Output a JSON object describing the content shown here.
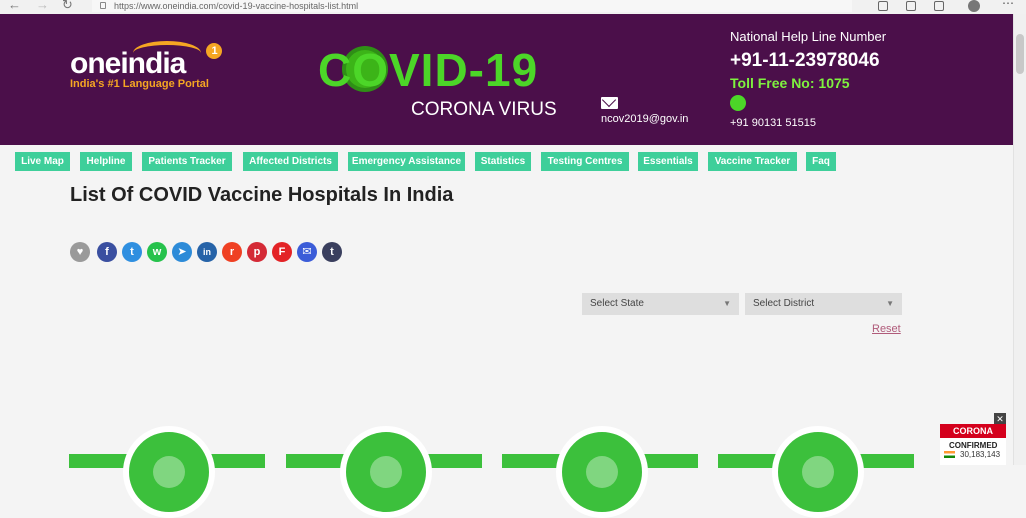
{
  "browser": {
    "url": "https://www.oneindia.com/covid-19-vaccine-hospitals-list.html"
  },
  "header": {
    "logo_text": "oneindia",
    "logo_badge": "1",
    "tagline": "India's #1 Language Portal",
    "covid_title": "COVID-19",
    "covid_subtitle": "CORONA VIRUS",
    "email": "ncov2019@gov.in",
    "helpline_label": "National Help Line Number",
    "helpline_number": "+91-11-23978046",
    "toll_free": "Toll Free No: 1075",
    "whatsapp_number": "+91 90131 51515"
  },
  "nav": {
    "tabs": [
      {
        "label": "Live Map"
      },
      {
        "label": "Helpline"
      },
      {
        "label": "Patients Tracker"
      },
      {
        "label": "Affected Districts"
      },
      {
        "label": "Emergency Assistance"
      },
      {
        "label": "Statistics"
      },
      {
        "label": "Testing Centres"
      },
      {
        "label": "Essentials"
      },
      {
        "label": "Vaccine Tracker"
      },
      {
        "label": "Faq"
      }
    ]
  },
  "main": {
    "title": "List Of COVID Vaccine Hospitals In India",
    "share_icons": [
      {
        "icon": "heart-icon",
        "glyph": "♥",
        "color": "#9a9a9a"
      },
      {
        "icon": "facebook-icon",
        "glyph": "f",
        "color": "#3a4fa0"
      },
      {
        "icon": "twitter-icon",
        "glyph": "t",
        "color": "#2f8fe0"
      },
      {
        "icon": "whatsapp-icon",
        "glyph": "w",
        "color": "#26c24c"
      },
      {
        "icon": "telegram-icon",
        "glyph": "➤",
        "color": "#2d8bd8"
      },
      {
        "icon": "linkedin-icon",
        "glyph": "in",
        "color": "#2663a8"
      },
      {
        "icon": "reddit-icon",
        "glyph": "r",
        "color": "#ef4023"
      },
      {
        "icon": "pinterest-icon",
        "glyph": "p",
        "color": "#d42a36"
      },
      {
        "icon": "flipboard-icon",
        "glyph": "F",
        "color": "#e32326"
      },
      {
        "icon": "email-icon",
        "glyph": "✉",
        "color": "#3b5cd8"
      },
      {
        "icon": "tumblr-icon",
        "glyph": "t",
        "color": "#3a3f5e"
      }
    ],
    "select_state": "Select State",
    "select_district": "Select District",
    "reset": "Reset"
  },
  "widget": {
    "title": "CORONA",
    "label": "CONFIRMED",
    "value": "30,183,143",
    "close": "✕"
  },
  "colors": {
    "header_bg": "#4b0f4a",
    "accent_green": "#4cd628",
    "tab_bg": "#3ecf9a",
    "card_green": "#3cc03c"
  }
}
